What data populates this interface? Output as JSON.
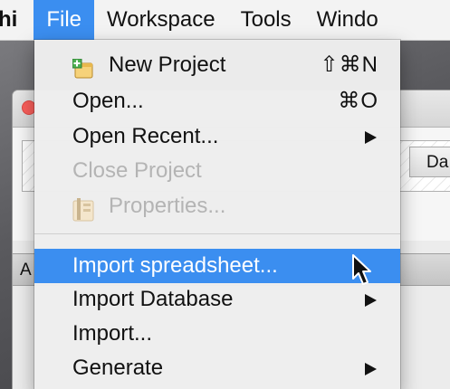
{
  "menubar": {
    "app_name": "hi",
    "items": [
      "File",
      "Workspace",
      "Tools",
      "Windo"
    ]
  },
  "background": {
    "tab_label": "Da",
    "strip_label": "A"
  },
  "file_menu": {
    "items": [
      {
        "label": "New Project",
        "shortcut": "⇧⌘N",
        "icon": "new-project-icon"
      },
      {
        "label": "Open...",
        "shortcut": "⌘O"
      },
      {
        "label": "Open Recent...",
        "submenu": true
      },
      {
        "label": "Close Project",
        "disabled": true
      },
      {
        "label": "Properties...",
        "disabled": true,
        "icon": "properties-icon"
      },
      {
        "label": "Import spreadsheet...",
        "highlighted": true
      },
      {
        "label": "Import Database",
        "submenu": true
      },
      {
        "label": "Import..."
      },
      {
        "label": "Generate",
        "submenu": true
      }
    ]
  },
  "colors": {
    "highlight": "#3b8ef0",
    "disabled_text": "#b4b4b4"
  }
}
